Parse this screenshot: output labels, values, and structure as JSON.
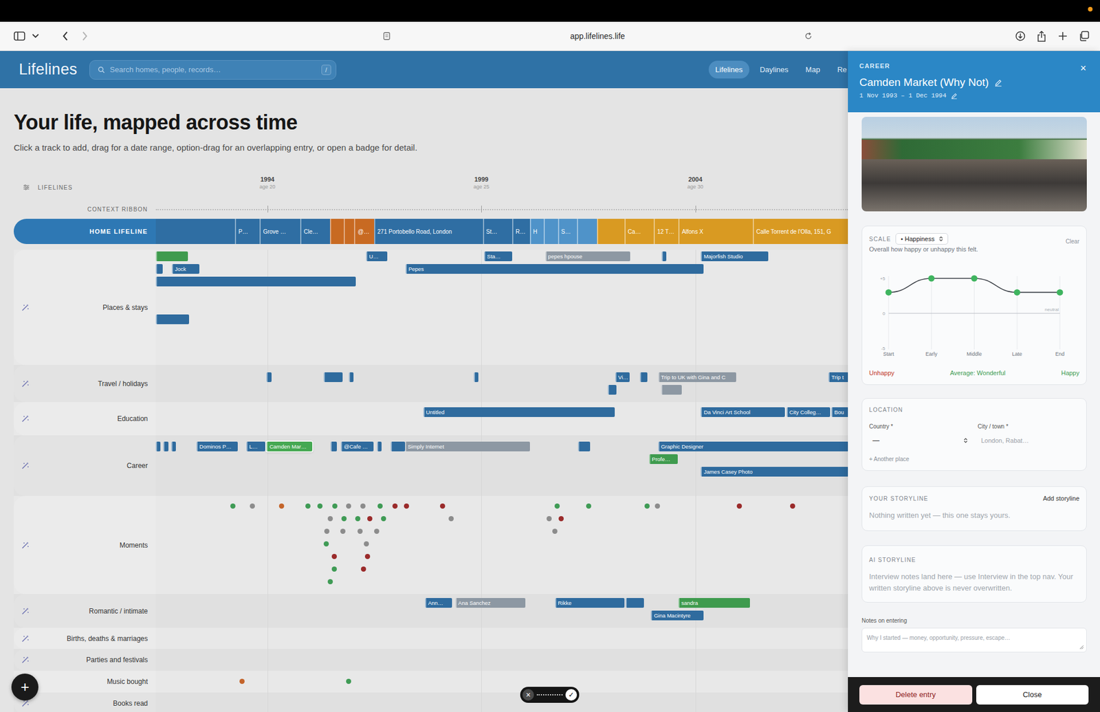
{
  "browser": {
    "url": "app.lifelines.life"
  },
  "app": {
    "logo": "Lifelines",
    "search": {
      "placeholder": "Search homes, people, records…",
      "shortcut": "/"
    },
    "nav": [
      {
        "label": "Lifelines",
        "selected": true
      },
      {
        "label": "Daylines",
        "selected": false
      },
      {
        "label": "Map",
        "selected": false
      },
      {
        "label": "Re",
        "selected": false
      }
    ]
  },
  "page": {
    "title": "Your life, mapped across time",
    "subtitle": "Click a track to add, drag for a date range, option-drag for an overlapping entry, or open a badge for detail."
  },
  "timeline": {
    "header_label": "LIFELINES",
    "axis": [
      {
        "year": "1994",
        "age": "age 20"
      },
      {
        "year": "1999",
        "age": "age 25"
      },
      {
        "year": "2004",
        "age": "age 30"
      }
    ],
    "context_label": "CONTEXT RIBBON",
    "home": {
      "label": "HOME LIFELINE",
      "segments": [
        {
          "label": "",
          "color": "#2f6ea3"
        },
        {
          "label": "P…",
          "color": "#2f6ea3"
        },
        {
          "label": "Grove …",
          "color": "#2f6ea3"
        },
        {
          "label": "Cle…",
          "color": "#2f6ea3"
        },
        {
          "label": "",
          "color": "#c86a22"
        },
        {
          "label": "",
          "color": "#c86a22"
        },
        {
          "label": "@…",
          "color": "#c86a22"
        },
        {
          "label": "271 Portobello Road, London",
          "color": "#2f6ea3"
        },
        {
          "label": "St…",
          "color": "#2f6ea3"
        },
        {
          "label": "R…",
          "color": "#2f6ea3"
        },
        {
          "label": "H",
          "color": "#4f93c9"
        },
        {
          "label": "",
          "color": "#4f93c9"
        },
        {
          "label": "S…",
          "color": "#4f93c9"
        },
        {
          "label": "",
          "color": "#4f93c9"
        },
        {
          "label": "",
          "color": "#d99a22"
        },
        {
          "label": "Ca…",
          "color": "#d99a22"
        },
        {
          "label": "12 T…",
          "color": "#d99a22"
        },
        {
          "label": "Alfons X",
          "color": "#d99a22"
        },
        {
          "label": "Calle Torrent de l'Olla, 151, G",
          "color": "#d99a22"
        }
      ]
    },
    "tracks": [
      {
        "label": "Places & stays",
        "kind": "bars",
        "items": [
          {
            "label": "",
            "color": "#3f9b4e",
            "selected": false
          },
          {
            "label": "U…",
            "color": "#2f6b9e",
            "selected": false
          },
          {
            "label": "Sta…",
            "color": "#2f6b9e",
            "selected": false
          },
          {
            "label": "pepes hpouse",
            "color": "#8d98a3",
            "selected": false
          },
          {
            "label": "",
            "color": "#2f6b9e",
            "selected": false
          },
          {
            "label": "Majorfish Studio",
            "color": "#2f6b9e",
            "selected": false
          },
          {
            "label": "",
            "color": "#2f6b9e",
            "selected": false
          },
          {
            "label": "Jock",
            "color": "#2f6b9e",
            "selected": false
          },
          {
            "label": "Pepes",
            "color": "#2f6b9e",
            "selected": false
          },
          {
            "label": "",
            "color": "#2f6b9e",
            "selected": false
          },
          {
            "label": "",
            "color": "#2f6b9e",
            "selected": false
          }
        ]
      },
      {
        "label": "Travel / holidays",
        "kind": "bars",
        "items": [
          {
            "label": "",
            "color": "#2f6b9e",
            "selected": false
          },
          {
            "label": "",
            "color": "#2f6b9e",
            "selected": false
          },
          {
            "label": "",
            "color": "#2f6b9e",
            "selected": false
          },
          {
            "label": "",
            "color": "#2f6b9e",
            "selected": false
          },
          {
            "label": "Vi…",
            "color": "#2f6b9e",
            "selected": false
          },
          {
            "label": "",
            "color": "#2f6b9e",
            "selected": false
          },
          {
            "label": "Trip to UK with Gina and C",
            "color": "#8d98a3",
            "selected": false
          },
          {
            "label": "Trip t",
            "color": "#2f6b9e",
            "selected": false
          },
          {
            "label": "",
            "color": "#2f6b9e",
            "selected": false
          },
          {
            "label": "",
            "color": "#8d98a3",
            "selected": false
          }
        ]
      },
      {
        "label": "Education",
        "kind": "bars",
        "items": [
          {
            "label": "Untitled",
            "color": "#2f6b9e",
            "selected": false
          },
          {
            "label": "Da Vinci Art School",
            "color": "#2f6b9e",
            "selected": false
          },
          {
            "label": "City Colleg…",
            "color": "#2f6b9e",
            "selected": false
          },
          {
            "label": "Bou",
            "color": "#2f6b9e",
            "selected": false
          }
        ]
      },
      {
        "label": "Career",
        "kind": "bars",
        "items": [
          {
            "label": "",
            "color": "#2f6b9e",
            "selected": false
          },
          {
            "label": "",
            "color": "#2f6b9e",
            "selected": false
          },
          {
            "label": "",
            "color": "#2f6b9e",
            "selected": false
          },
          {
            "label": "Dominos P…",
            "color": "#2f6b9e",
            "selected": false
          },
          {
            "label": "L…",
            "color": "#2f6b9e",
            "selected": false
          },
          {
            "label": "Camden Mar…",
            "color": "#45a852",
            "selected": true
          },
          {
            "label": "",
            "color": "#2f6b9e",
            "selected": false
          },
          {
            "label": "@Cafe …",
            "color": "#2f6b9e",
            "selected": false
          },
          {
            "label": "",
            "color": "#2f6b9e",
            "selected": false
          },
          {
            "label": "",
            "color": "#2f6b9e",
            "selected": false
          },
          {
            "label": "Simply Internet",
            "color": "#8d98a3",
            "selected": false
          },
          {
            "label": "",
            "color": "#2f6b9e",
            "selected": false
          },
          {
            "label": "Graphic Designer",
            "color": "#2f6b9e",
            "selected": false
          },
          {
            "label": "Profe…",
            "color": "#3f9b4e",
            "selected": false
          },
          {
            "label": "James Casey Photo",
            "color": "#2f6b9e",
            "selected": false
          }
        ]
      },
      {
        "label": "Moments",
        "kind": "dots",
        "items": [
          {
            "color": "#3f9b55"
          },
          {
            "color": "#8c8c8c"
          },
          {
            "color": "#c4642a"
          },
          {
            "color": "#3f9b55"
          },
          {
            "color": "#3f9b55"
          },
          {
            "color": "#3f9b55"
          },
          {
            "color": "#8c8c8c"
          },
          {
            "color": "#8c8c8c"
          },
          {
            "color": "#3f9b55"
          },
          {
            "color": "#9a2a2a"
          },
          {
            "color": "#9a2a2a"
          },
          {
            "color": "#9a2a2a"
          },
          {
            "color": "#3f9b55"
          },
          {
            "color": "#3f9b55"
          },
          {
            "color": "#3f9b55"
          },
          {
            "color": "#8c8c8c"
          },
          {
            "color": "#9a2a2a"
          },
          {
            "color": "#9a2a2a"
          },
          {
            "color": "#8c8c8c"
          },
          {
            "color": "#3f9b55"
          },
          {
            "color": "#3f9b55"
          },
          {
            "color": "#9a2a2a"
          },
          {
            "color": "#3f9b55"
          },
          {
            "color": "#8c8c8c"
          },
          {
            "color": "#8c8c8c"
          },
          {
            "color": "#9a2a2a"
          },
          {
            "color": "#8c8c8c"
          },
          {
            "color": "#8c8c8c"
          },
          {
            "color": "#8c8c8c"
          },
          {
            "color": "#8c8c8c"
          },
          {
            "color": "#8c8c8c"
          },
          {
            "color": "#3f9b55"
          },
          {
            "color": "#8c8c8c"
          },
          {
            "color": "#9a2a2a"
          },
          {
            "color": "#9a2a2a"
          },
          {
            "color": "#3f9b55"
          },
          {
            "color": "#9a2a2a"
          },
          {
            "color": "#3f9b55"
          }
        ]
      },
      {
        "label": "Romantic / intimate",
        "kind": "bars",
        "items": [
          {
            "label": "Ann…",
            "color": "#2f6b9e",
            "selected": false
          },
          {
            "label": "Ana Sanchez",
            "color": "#8d98a3",
            "selected": false
          },
          {
            "label": "Rikke",
            "color": "#2f6b9e",
            "selected": false
          },
          {
            "label": "",
            "color": "#2f6b9e",
            "selected": false
          },
          {
            "label": "sandra",
            "color": "#3f9b4e",
            "selected": false
          },
          {
            "label": "Gina Macintyre",
            "color": "#2f6b9e",
            "selected": false
          }
        ]
      },
      {
        "label": "Births, deaths & marriages",
        "kind": "bars",
        "items": []
      },
      {
        "label": "Parties and festivals",
        "kind": "bars",
        "items": []
      },
      {
        "label": "Music bought",
        "kind": "dots",
        "items": [
          {
            "color": "#c4642a"
          },
          {
            "color": "#3f9b55"
          }
        ]
      },
      {
        "label": "Books read",
        "kind": "bars",
        "items": []
      }
    ]
  },
  "panel": {
    "category": "CAREER",
    "title": "Camden Market (Why Not)",
    "dates": "1 Nov 1993 – 1 Dec 1994",
    "close": "×",
    "scale": {
      "label": "SCALE",
      "select": "• Happiness",
      "clear": "Clear",
      "hint": "Overall how happy or unhappy this felt.",
      "ticks": [
        "+5",
        "0",
        "-5"
      ],
      "neutral_label": "neutral",
      "points": [
        "Start",
        "Early",
        "Middle",
        "Late",
        "End"
      ],
      "values": [
        3,
        5,
        5,
        3,
        3
      ],
      "low": "Unhappy",
      "average": "Average: Wonderful",
      "high": "Happy"
    },
    "location": {
      "title": "LOCATION",
      "country_label": "Country *",
      "country_value": "—",
      "city_label": "City / town *",
      "city_placeholder": "London, Rabat…",
      "add": "+ Another place"
    },
    "storyline": {
      "title": "YOUR STORYLINE",
      "action": "Add storyline",
      "empty": "Nothing written yet — this one stays yours."
    },
    "ai_storyline": {
      "title": "AI STORYLINE",
      "text": "Interview notes land here — use Interview in the top nav. Your written storyline above is never overwritten."
    },
    "notes": {
      "label": "Notes on entering",
      "placeholder": "Why I started — money, opportunity, pressure, escape…"
    },
    "footer": {
      "delete": "Delete entry",
      "close": "Close"
    }
  },
  "confirm_bar": {
    "cancel": "×",
    "confirm": "✓"
  },
  "fab": {
    "label": "+"
  }
}
